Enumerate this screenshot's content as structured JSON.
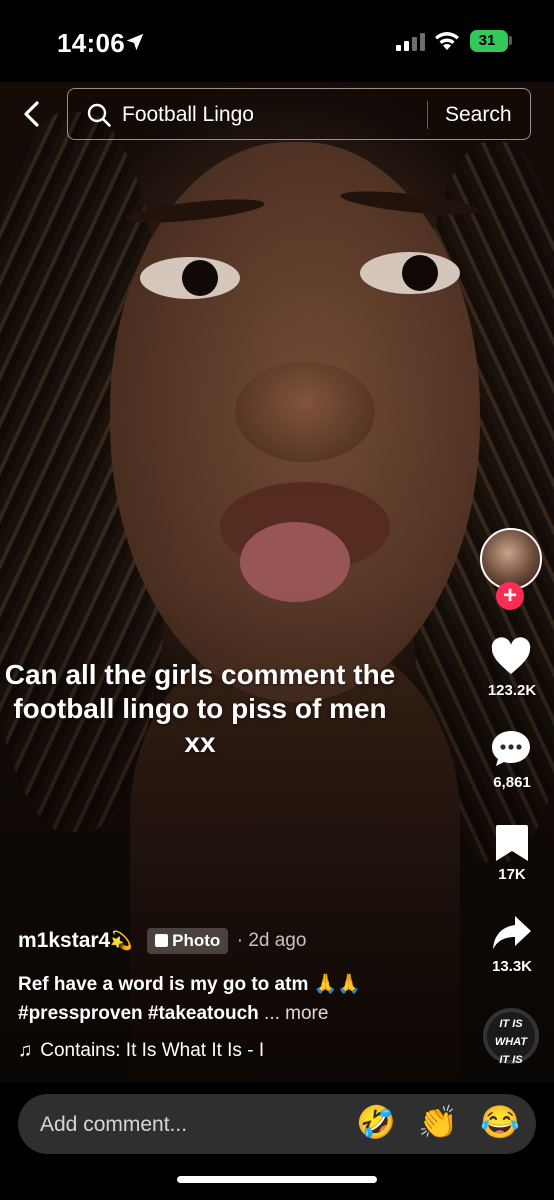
{
  "status_bar": {
    "time": "14:06",
    "battery": "31",
    "icons": [
      "location-arrow-icon",
      "signal-icon",
      "wifi-icon",
      "battery-icon"
    ]
  },
  "search": {
    "query": "Football Lingo",
    "button_label": "Search"
  },
  "video": {
    "overlay_text": "Can all the girls comment the football lingo to piss of men xx"
  },
  "actions": {
    "follow_label": "+",
    "like_count": "123.2K",
    "comment_count": "6,861",
    "save_count": "17K",
    "share_count": "13.3K",
    "music_disc_text": [
      "IT IS",
      "WHAT",
      "IT IS"
    ]
  },
  "caption": {
    "author": "m1kstar4",
    "author_emoji": "💫",
    "badge_label": "Photo",
    "date": "· 2d ago",
    "text": "Ref have a word is my go to atm 🙏🙏",
    "hashtags": "#pressproven #takeatouch",
    "more_label": "... more",
    "music": "Contains: It Is What It Is - I"
  },
  "comment_bar": {
    "placeholder": "Add comment...",
    "emojis": [
      "🤣",
      "👏",
      "😂"
    ]
  },
  "colors": {
    "accent": "#fe2c55",
    "battery": "#34c759"
  }
}
